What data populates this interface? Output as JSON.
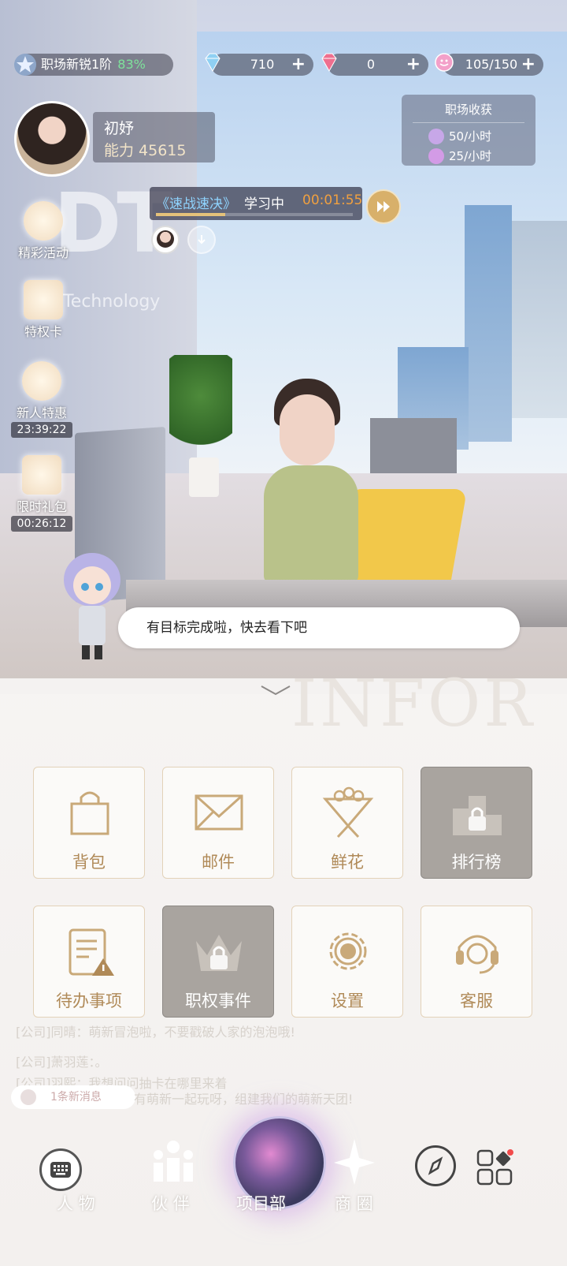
{
  "top_bar": {
    "rank_label": "职场新锐1阶",
    "rank_percent": "83%",
    "diamond_blue": "710",
    "diamond_red": "0",
    "stamina": "105/150",
    "plus": "+"
  },
  "profile": {
    "name": "初妤",
    "ability": "能力 45615"
  },
  "harvest": {
    "title": "职场收获",
    "rate1": "50/小时",
    "rate2": "25/小时"
  },
  "study": {
    "course": "《速战速决》",
    "status": "学习中",
    "timer": "00:01:55",
    "progress": 0.35
  },
  "side_menu": {
    "events": "精彩活动",
    "privilege": "特权卡",
    "newbie": "新人特惠",
    "newbie_timer": "23:39:22",
    "gift": "限时礼包",
    "gift_timer": "00:26:12"
  },
  "scene": {
    "logo_letters": "DT",
    "logo_text": "D  & Technology"
  },
  "assistant": {
    "message": "有目标完成啦，快去看下吧"
  },
  "panel": {
    "watermark": "INFOR",
    "tiles": {
      "bag": "背包",
      "mail": "邮件",
      "flowers": "鲜花",
      "ranking": "排行榜",
      "todo": "待办事项",
      "authority": "职权事件",
      "settings": "设置",
      "service": "客服"
    }
  },
  "chat": {
    "line1": "[公司]同晴：萌新冒泡啦，不要戳破人家的泡泡哦!",
    "line2": "[公司]萧羽莲：。",
    "line3": "[公司]羽熙：我想问问抽卡在哪里来着",
    "recruit_label": "1条新消息",
    "recruit_tail": "有萌新一起玩呀，组建我们的萌新天团!"
  },
  "bottom_nav": {
    "people": "人 物",
    "partners": "伙 伴",
    "project": "项目部",
    "business": "商 圈"
  },
  "colors": {
    "accent_gold": "#b08a58",
    "percent_green": "#7ee29b",
    "timer_orange": "#f0a040"
  }
}
